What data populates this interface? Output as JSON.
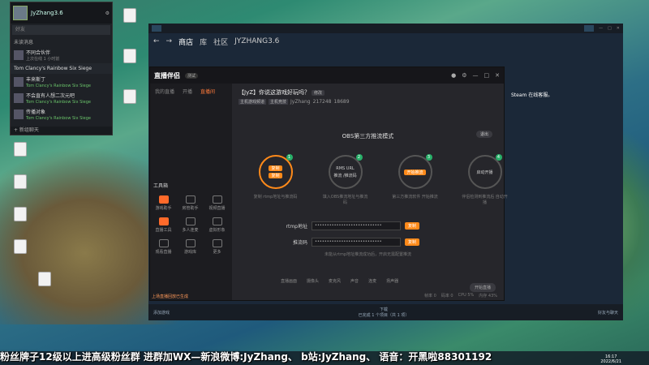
{
  "desktop": {
    "icons": [
      {
        "label": "",
        "x": 0
      },
      {
        "label": "",
        "x": 0
      },
      {
        "label": "",
        "x": 0
      },
      {
        "label": "",
        "x": 0
      },
      {
        "label": "",
        "x": 0
      },
      {
        "label": "",
        "x": 0
      },
      {
        "label": "",
        "x": 0
      },
      {
        "label": "",
        "x": 0
      }
    ]
  },
  "friends": {
    "username": "JyZhang3.6",
    "search_placeholder": "好友",
    "section_pending": "未读消息",
    "pending_item": {
      "name": "不同合伙伴",
      "sub": "上次在线 1 小时前"
    },
    "game_group": "Tom Clancy's Rainbow Six Siege",
    "friends": [
      {
        "name": "丰来斯丁",
        "game": "Tom Clancy's Rainbow Six Siege"
      },
      {
        "name": "不会直有人想二次元吧",
        "game": "Tom Clancy's Rainbow Six Siege"
      },
      {
        "name": "传播对象",
        "game": "Tom Clancy's Rainbow Six Siege"
      }
    ],
    "footer": "+ 新组聊天"
  },
  "steam": {
    "nav": [
      "商店",
      "库",
      "社区",
      "JYZHANG3.6"
    ],
    "side_text": "Steam 在线客服。",
    "bottom_left": "添加游戏",
    "bottom_center": "下载",
    "bottom_center_sub": "已完成 1 个项目（共 1 项）",
    "bottom_right": "好友与聊天"
  },
  "app": {
    "logo": "直播伴侣",
    "version": "测试",
    "tabs": [
      "我的直播",
      "开播",
      "直播间"
    ],
    "tools_title": "工具箱",
    "tools": [
      "游戏助手",
      "房管助手",
      "视频直播",
      "直播工具",
      "多人连麦",
      "虚拟形象",
      "观看直播",
      "游戏库",
      "更多"
    ],
    "alert": "上场直播回放已生成",
    "room_title": "【JyZ】你说这游戏好玩吗？",
    "edit_label": "修改",
    "tags": [
      "主机游戏频道",
      "主机竞技"
    ],
    "streamer": "JyZhang",
    "fans": "217248",
    "hot": "18689",
    "obs_title": "OBS第三方推流模式",
    "exit": "退出",
    "steps": [
      {
        "num": "1",
        "lines": [
          "复制",
          "复制"
        ],
        "cap": "复制 rtmp地址与推流码"
      },
      {
        "num": "2",
        "lines": [
          "RMS URL",
          "推流 /推流码"
        ],
        "cap": "填入OBS推流地址与推流码"
      },
      {
        "num": "3",
        "lines": [
          "开始推流"
        ],
        "cap": "第三方推流软件 开始推流"
      },
      {
        "num": "4",
        "lines": [
          "启动开播"
        ],
        "cap": "伴侣检测到推流后 自动开播"
      }
    ],
    "rtmp_label": "rtmp地址",
    "rtmp_value": "••••••••••••••••••••••••••••",
    "key_label": "推流码",
    "key_value": "••••••••••••••••••••••••••••",
    "copy": "复制",
    "hint": "未能从rtmp地址推流成功后，开启无需配置推流",
    "toolbar": [
      "直播画面",
      "摄像头",
      "麦克风",
      "声音",
      "连麦",
      "扬声器"
    ],
    "live_button": "开始直播",
    "status": [
      "帧率 0",
      "码率 0",
      "CPU 5%",
      "内存 43%"
    ]
  },
  "overlay": {
    "marquee": "粉丝牌子12级以上进高级粉丝群  进群加WX—新浪微博:JyZhang、  b站:JyZhang、  语音：开黑啦88301192"
  },
  "clock": {
    "time": "16:17",
    "date": "2022/6/21"
  }
}
